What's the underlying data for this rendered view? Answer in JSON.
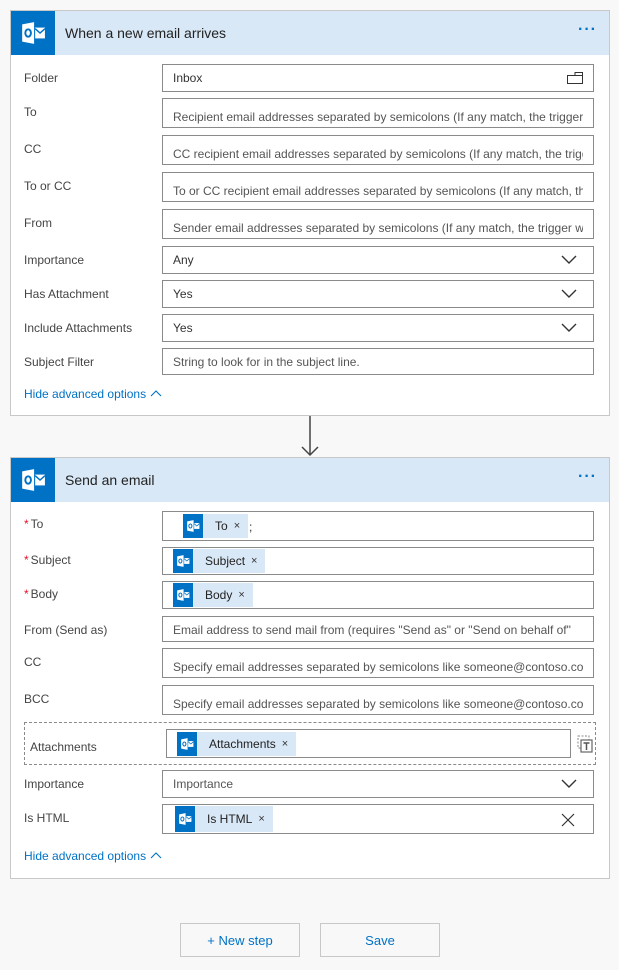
{
  "trigger": {
    "title": "When a new email arrives",
    "more_label": "···",
    "fields": [
      {
        "label": "Folder",
        "value": "Inbox",
        "kind": "picker"
      },
      {
        "label": "To",
        "placeholder": "Recipient email addresses separated by semicolons (If any match, the trigger ...",
        "kind": "text"
      },
      {
        "label": "CC",
        "placeholder": "CC recipient email addresses separated by semicolons (If any match, the trigg...",
        "kind": "text"
      },
      {
        "label": "To or CC",
        "placeholder": "To or CC recipient email addresses separated by semicolons (If any match, th...",
        "kind": "text"
      },
      {
        "label": "From",
        "placeholder": "Sender email addresses separated by semicolons (If any match, the trigger wi...",
        "kind": "text"
      },
      {
        "label": "Importance",
        "value": "Any",
        "kind": "dropdown"
      },
      {
        "label": "Has Attachment",
        "value": "Yes",
        "kind": "dropdown"
      },
      {
        "label": "Include Attachments",
        "value": "Yes",
        "kind": "dropdown"
      },
      {
        "label": "Subject Filter",
        "placeholder": "String to look for in the subject line.",
        "kind": "text"
      }
    ],
    "advanced_link": "Hide advanced options"
  },
  "action": {
    "title": "Send an email",
    "more_label": "···",
    "fields": [
      {
        "label": "To",
        "required": true,
        "token": "To",
        "suffix": ";"
      },
      {
        "label": "Subject",
        "required": true,
        "token": "Subject"
      },
      {
        "label": "Body",
        "required": true,
        "token": "Body"
      },
      {
        "label": "From (Send as)",
        "placeholder": "Email address to send mail from (requires \"Send as\" or \"Send on behalf of\""
      },
      {
        "label": "CC",
        "placeholder": "Specify email addresses separated by semicolons like someone@contoso.com"
      },
      {
        "label": "BCC",
        "placeholder": "Specify email addresses separated by semicolons like someone@contoso.com"
      },
      {
        "label": "Attachments",
        "token": "Attachments"
      },
      {
        "label": "Importance",
        "placeholder": "Importance",
        "kind": "dropdown"
      },
      {
        "label": "Is HTML",
        "token": "Is HTML",
        "kind": "clearable"
      }
    ],
    "required_mark": "*",
    "token_remove": "×",
    "advanced_link": "Hide advanced options"
  },
  "footer": {
    "new_step_label": "+ New step",
    "save_label": "Save"
  },
  "colors": {
    "accent": "#0072c6",
    "header_bg": "#d9e8f6",
    "token_bg": "#d9e8f6",
    "required": "#e81123",
    "page_bg": "#f8f8f8"
  }
}
